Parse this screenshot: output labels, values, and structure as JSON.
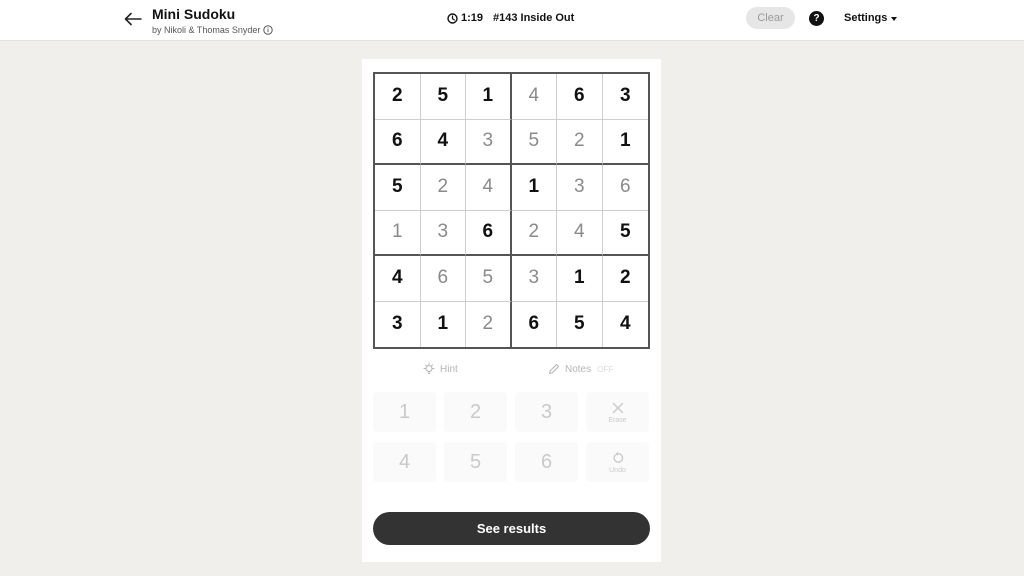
{
  "header": {
    "title": "Mini Sudoku",
    "byline": "by Nikoli & Thomas Snyder",
    "timer": "1:19",
    "puzzle_label": "#143 Inside Out",
    "clear_label": "Clear",
    "help_label": "?",
    "settings_label": "Settings"
  },
  "grid": {
    "rows": [
      [
        {
          "v": "2",
          "given": true
        },
        {
          "v": "5",
          "given": true
        },
        {
          "v": "1",
          "given": true
        },
        {
          "v": "4",
          "given": false
        },
        {
          "v": "6",
          "given": true
        },
        {
          "v": "3",
          "given": true
        }
      ],
      [
        {
          "v": "6",
          "given": true
        },
        {
          "v": "4",
          "given": true
        },
        {
          "v": "3",
          "given": false
        },
        {
          "v": "5",
          "given": false
        },
        {
          "v": "2",
          "given": false
        },
        {
          "v": "1",
          "given": true
        }
      ],
      [
        {
          "v": "5",
          "given": true
        },
        {
          "v": "2",
          "given": false
        },
        {
          "v": "4",
          "given": false
        },
        {
          "v": "1",
          "given": true
        },
        {
          "v": "3",
          "given": false
        },
        {
          "v": "6",
          "given": false
        }
      ],
      [
        {
          "v": "1",
          "given": false
        },
        {
          "v": "3",
          "given": false
        },
        {
          "v": "6",
          "given": true
        },
        {
          "v": "2",
          "given": false
        },
        {
          "v": "4",
          "given": false
        },
        {
          "v": "5",
          "given": true
        }
      ],
      [
        {
          "v": "4",
          "given": true
        },
        {
          "v": "6",
          "given": false
        },
        {
          "v": "5",
          "given": false
        },
        {
          "v": "3",
          "given": false
        },
        {
          "v": "1",
          "given": true
        },
        {
          "v": "2",
          "given": true
        }
      ],
      [
        {
          "v": "3",
          "given": true
        },
        {
          "v": "1",
          "given": true
        },
        {
          "v": "2",
          "given": false
        },
        {
          "v": "6",
          "given": true
        },
        {
          "v": "5",
          "given": true
        },
        {
          "v": "4",
          "given": true
        }
      ]
    ]
  },
  "tools": {
    "hint_label": "Hint",
    "notes_label": "Notes",
    "notes_state": "OFF"
  },
  "keypad": {
    "row1": [
      "1",
      "2",
      "3"
    ],
    "row2": [
      "4",
      "5",
      "6"
    ],
    "erase_label": "Erase",
    "undo_label": "Undo"
  },
  "results_label": "See results"
}
